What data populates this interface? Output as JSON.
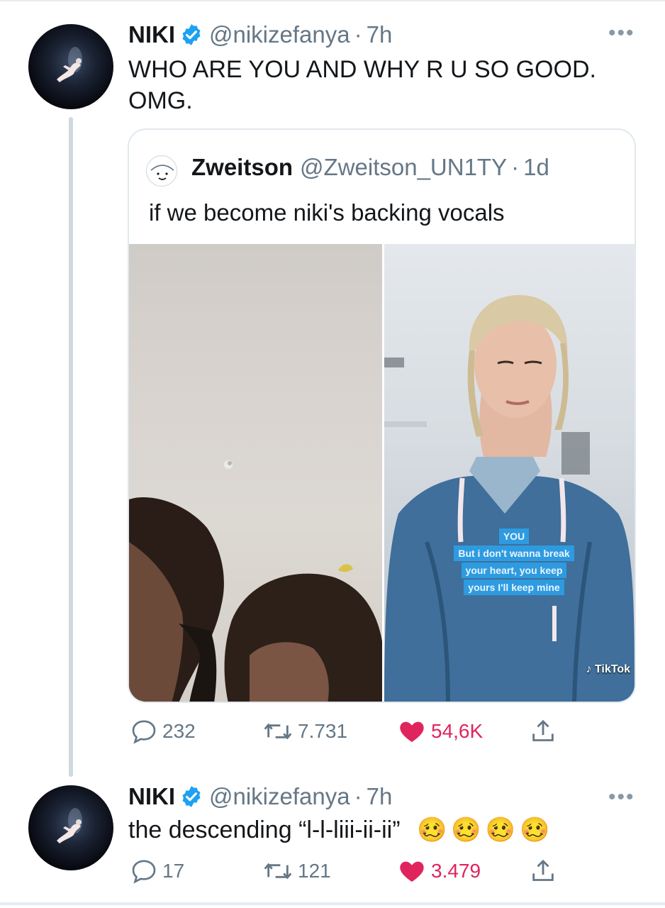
{
  "tweet1": {
    "name": "NIKI",
    "handle": "@nikizefanya",
    "time": "7h",
    "text_line1": "WHO ARE YOU AND WHY R U SO GOOD.",
    "text_line2": "OMG.",
    "more_icon": "more-icon",
    "quote": {
      "name": "Zweitson",
      "handle": "@Zweitson_UN1TY",
      "time": "1d",
      "text": "if we become niki's backing vocals",
      "overlay": {
        "line0": "YOU",
        "line1": "But i don't wanna break",
        "line2": "your heart, you keep",
        "line3": "yours I'll keep mine"
      },
      "watermark": "TikTok"
    },
    "stats": {
      "replies": "232",
      "retweets": "7.731",
      "likes": "54,6K"
    }
  },
  "tweet2": {
    "name": "NIKI",
    "handle": "@nikizefanya",
    "time": "7h",
    "text": "the descending “l-l-liii-ii-ii”",
    "emojis": "🥴🥴🥴🥴",
    "stats": {
      "replies": "17",
      "retweets": "121",
      "likes": "3.479"
    }
  },
  "colors": {
    "verified": "#1da1f2",
    "like": "#e0245e",
    "muted": "#657786",
    "lyric_bg": "#2e9be0"
  }
}
